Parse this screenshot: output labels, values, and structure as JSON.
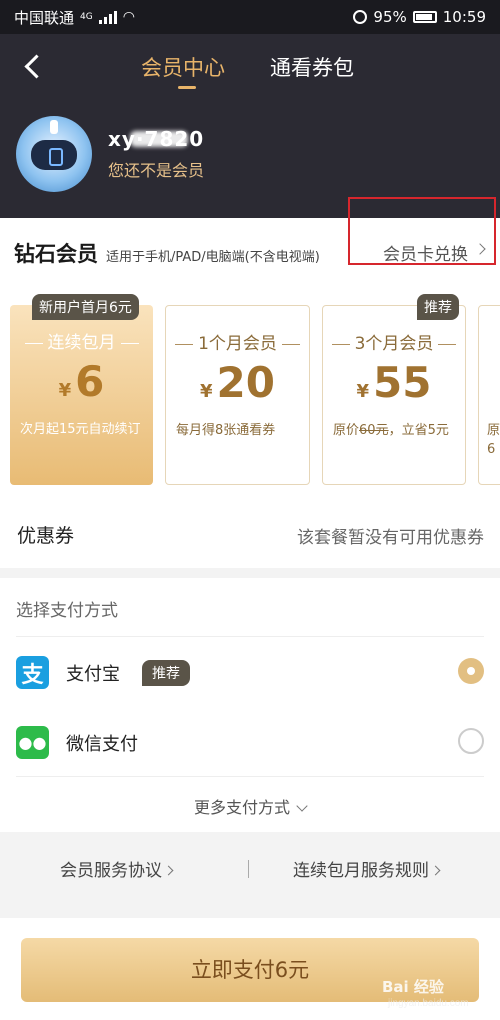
{
  "status_bar": {
    "carrier": "中国联通",
    "network": "4G",
    "battery": "95%",
    "time": "10:59"
  },
  "header": {
    "tab_active": "会员中心",
    "tab_other": "通看券包",
    "user": {
      "name": "xy·7820",
      "subtitle": "您还不是会员"
    }
  },
  "membership": {
    "title": "钻石会员",
    "subtitle": "适用于手机/PAD/电脑端(不含电视端)",
    "redeem_label": "会员卡兑换",
    "plans": [
      {
        "badge": "新用户首月6元",
        "title": "连续包月",
        "currency": "¥",
        "price": "6",
        "desc": "次月起15元自动续订",
        "selected": true
      },
      {
        "badge": "",
        "title": "1个月会员",
        "currency": "¥",
        "price": "20",
        "desc": "每月得8张通看券",
        "selected": false
      },
      {
        "badge": "推荐",
        "title": "3个月会员",
        "currency": "¥",
        "price": "55",
        "desc_prefix": "原价",
        "desc_strike": "60元",
        "desc_suffix": "，立省5元",
        "selected": false
      },
      {
        "badge": "",
        "title": "",
        "currency": "",
        "price": "",
        "desc": "原6",
        "selected": false
      }
    ]
  },
  "coupon": {
    "label": "优惠券",
    "value": "该套餐暂没有可用优惠券"
  },
  "payment": {
    "heading": "选择支付方式",
    "methods": [
      {
        "label": "支付宝",
        "badge": "推荐",
        "icon": "alipay-icon",
        "selected": true
      },
      {
        "label": "微信支付",
        "badge": "",
        "icon": "wechat-icon",
        "selected": false
      }
    ],
    "more": "更多支付方式"
  },
  "links": {
    "agreement": "会员服务协议",
    "rules": "连续包月服务规则"
  },
  "cta": {
    "label": "立即支付6元"
  },
  "watermark": {
    "text": "Bai 经验",
    "sub": "jingyan.baidu.com"
  },
  "colors": {
    "header_bg": "#2b2a33",
    "accent_gold": "#e8b46a",
    "highlight_red": "#d6262d"
  }
}
